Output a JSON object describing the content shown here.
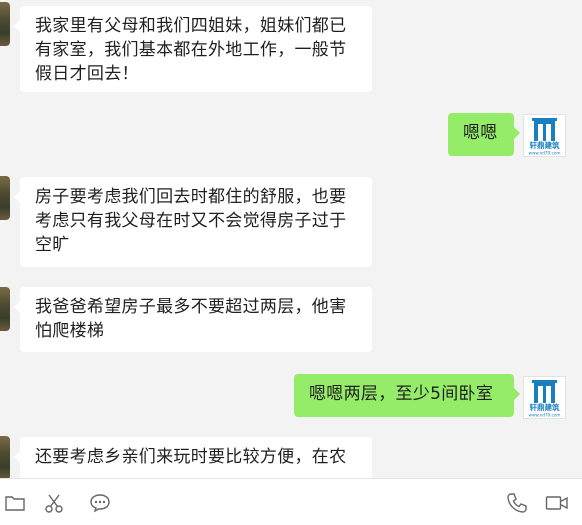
{
  "messages": [
    {
      "side": "left",
      "text": "我家里有父母和我们四姐妹，姐妹们都已有家室，我们基本都在外地工作，一般节假日才回去！"
    },
    {
      "side": "right",
      "text": "嗯嗯"
    },
    {
      "side": "left",
      "text": "房子要考虑我们回去时都住的舒服，也要考虑只有我父母在时又不会觉得房子过于空旷"
    },
    {
      "side": "left",
      "text": "我爸爸希望房子最多不要超过两层，他害怕爬楼梯"
    },
    {
      "side": "right",
      "text": "嗯嗯两层，至少5间卧室"
    },
    {
      "side": "left",
      "text": "还要考虑乡亲们来玩时要比较方便，在农"
    }
  ],
  "avatar_right": {
    "brand_text": "轩鼎建筑",
    "url_text": "www.xd79.com",
    "color": "#1a7fc1"
  },
  "toolbar": {
    "icons": [
      "folder-icon",
      "scissors-icon",
      "emoji-icon",
      "phone-icon",
      "video-icon"
    ]
  },
  "colors": {
    "bubble_right": "#95ec69",
    "bubble_left": "#ffffff",
    "background": "#f3f3f3"
  }
}
